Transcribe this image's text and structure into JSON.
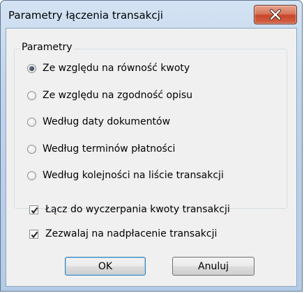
{
  "window": {
    "title": "Parametry łączenia transakcji",
    "close_label": "X"
  },
  "group": {
    "label": "Parametry",
    "options": [
      {
        "label": "Ze względu na równość kwoty",
        "selected": true
      },
      {
        "label": "Ze względu na zgodność opisu",
        "selected": false
      },
      {
        "label": "Według daty dokumentów",
        "selected": false
      },
      {
        "label": "Według terminów płatności",
        "selected": false
      },
      {
        "label": "Według kolejności na liście transakcji",
        "selected": false
      }
    ]
  },
  "checkboxes": [
    {
      "label": "Łącz do wyczerpania kwoty transakcji",
      "checked": true
    },
    {
      "label": "Zezwalaj na nadpłacenie transakcji",
      "checked": true
    }
  ],
  "buttons": {
    "ok": "OK",
    "cancel": "Anuluj"
  },
  "icons": {
    "close": "close-icon",
    "check": "check-icon",
    "radio_dot": "radio-dot-icon"
  }
}
